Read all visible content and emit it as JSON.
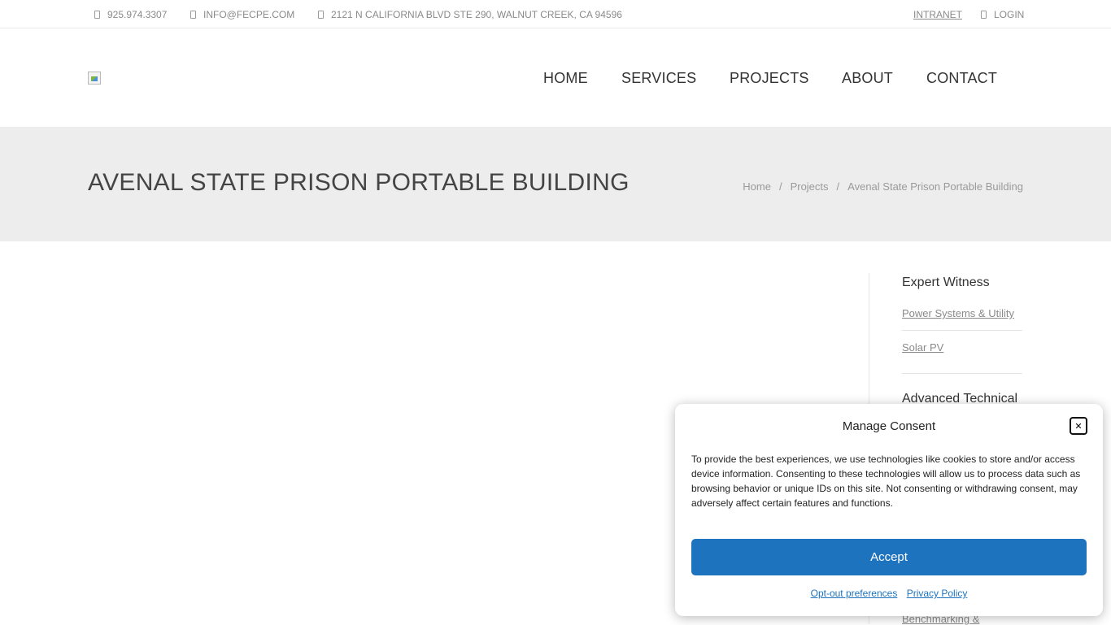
{
  "topbar": {
    "phone": "925.974.3307",
    "email": "INFO@FECPE.COM",
    "address": "2121 N CALIFORNIA BLVD STE 290, WALNUT CREEK, CA 94596",
    "intranet": "INTRANET",
    "login": "LOGIN"
  },
  "nav": {
    "items": [
      "HOME",
      "SERVICES",
      "PROJECTS",
      "ABOUT",
      "CONTACT"
    ]
  },
  "page": {
    "title": "AVENAL STATE PRISON PORTABLE BUILDING",
    "breadcrumb": [
      "Home",
      "Projects",
      "Avenal State Prison Portable Building"
    ],
    "breadcrumb_separator": "/"
  },
  "sidebar": {
    "sections": [
      {
        "heading": "Expert Witness",
        "items": [
          "Power Systems & Utility",
          "Solar PV"
        ]
      },
      {
        "heading": "Advanced Technical",
        "items": []
      }
    ],
    "partial_item": "Benchmarking &"
  },
  "consent": {
    "title": "Manage Consent",
    "text": "To provide the best experiences, we use technologies like cookies to store and/or access device information. Consenting to these technologies will allow us to process data such as browsing behavior or unique IDs on this site. Not consenting or withdrawing consent, may adversely affect certain features and functions.",
    "accept": "Accept",
    "optout": "Opt-out preferences",
    "privacy": "Privacy Policy",
    "accent_color": "#1e73be"
  }
}
